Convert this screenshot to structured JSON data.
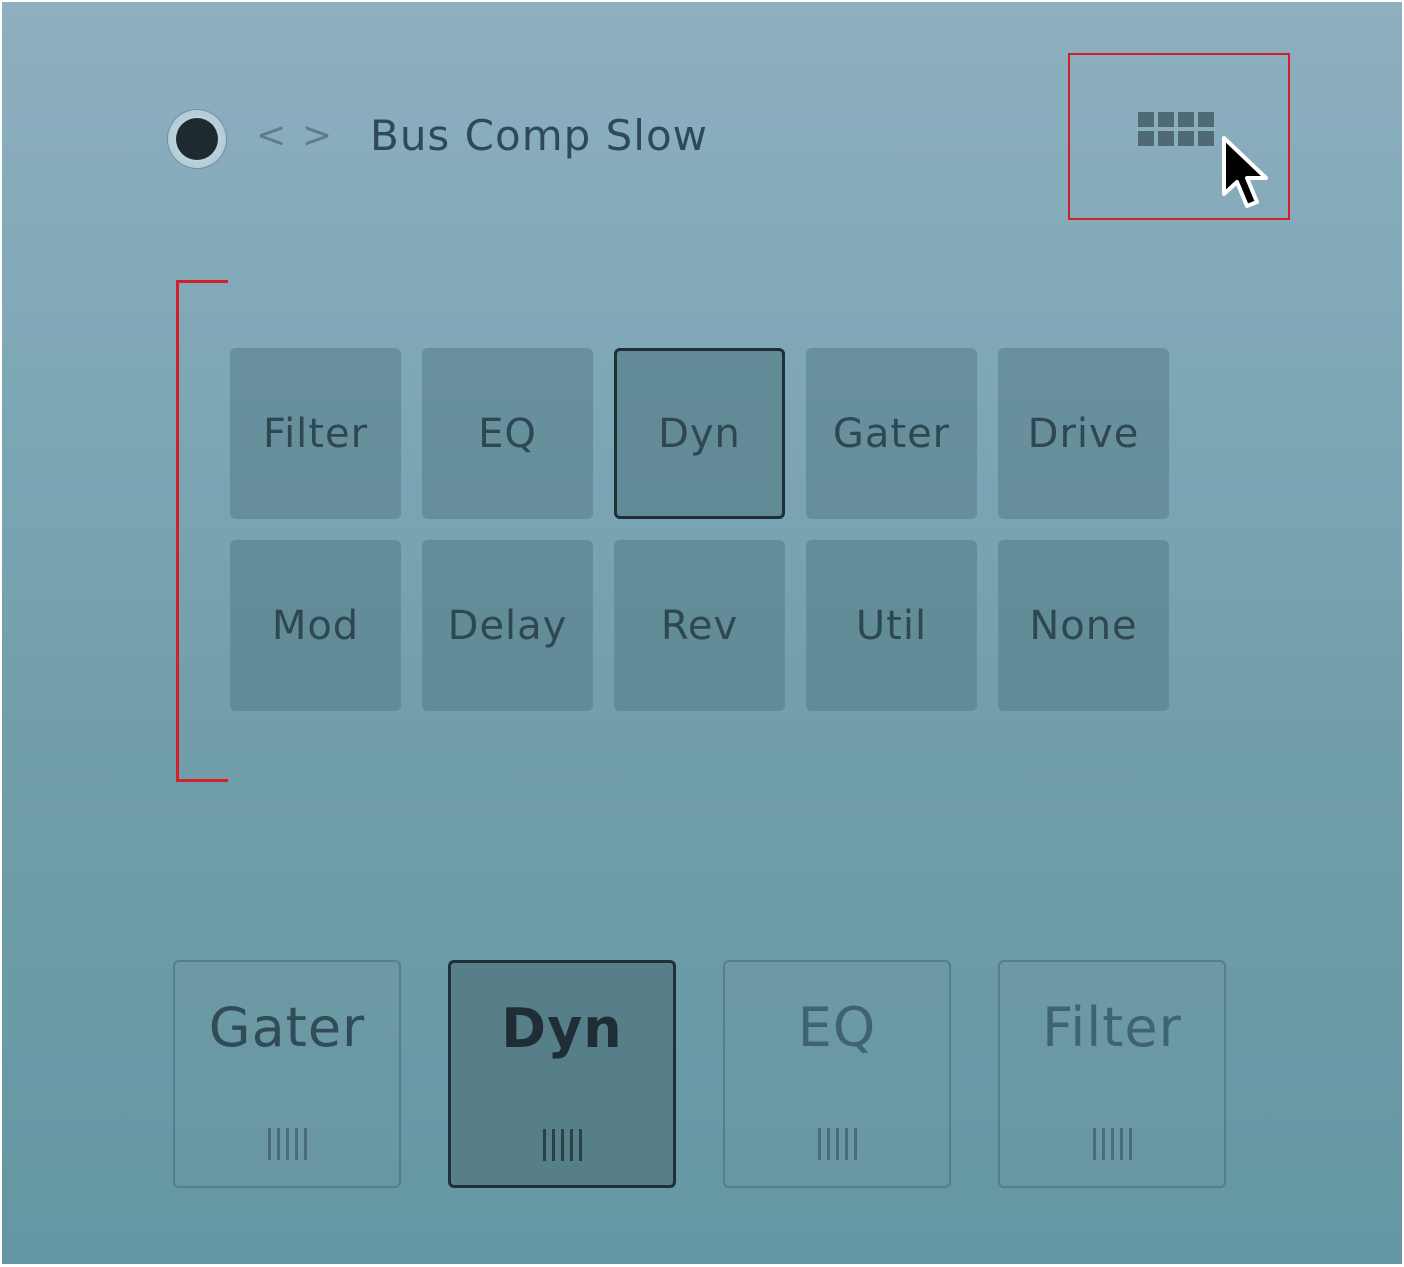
{
  "header": {
    "prev_arrow": "<",
    "next_arrow": ">",
    "preset_name": "Bus Comp Slow"
  },
  "icons": {
    "power": "power-toggle-icon",
    "grid_toggle": "grid-view-icon",
    "cursor": "mouse-pointer-icon",
    "slot_handle": "drag-handle-icon"
  },
  "colors": {
    "annotation": "#d0202a",
    "selected_border": "#1f3038",
    "panel_top": "#8eb0c1",
    "panel_bottom": "#6497a3"
  },
  "module_grid": {
    "selected": "Dyn",
    "rows": [
      [
        "Filter",
        "EQ",
        "Dyn",
        "Gater",
        "Drive"
      ],
      [
        "Mod",
        "Delay",
        "Rev",
        "Util",
        "None"
      ]
    ]
  },
  "slots": [
    {
      "label": "Gater",
      "state": "normal"
    },
    {
      "label": "Dyn",
      "state": "active"
    },
    {
      "label": "EQ",
      "state": "dim"
    },
    {
      "label": "Filter",
      "state": "dim"
    }
  ]
}
